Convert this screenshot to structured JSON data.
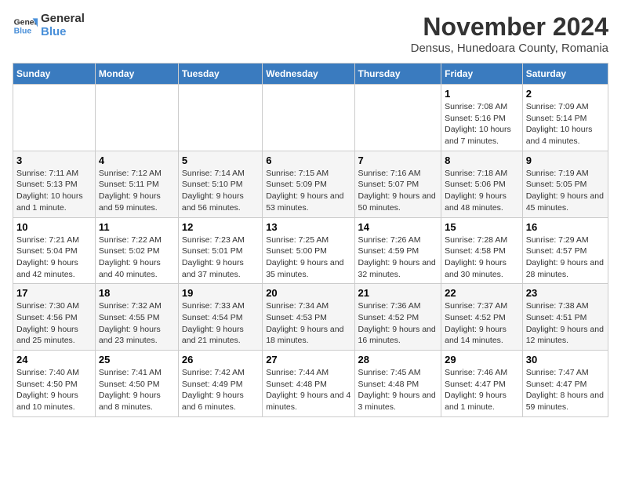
{
  "logo": {
    "line1": "General",
    "line2": "Blue"
  },
  "title": "November 2024",
  "subtitle": "Densus, Hunedoara County, Romania",
  "headers": [
    "Sunday",
    "Monday",
    "Tuesday",
    "Wednesday",
    "Thursday",
    "Friday",
    "Saturday"
  ],
  "weeks": [
    [
      {
        "day": "",
        "info": ""
      },
      {
        "day": "",
        "info": ""
      },
      {
        "day": "",
        "info": ""
      },
      {
        "day": "",
        "info": ""
      },
      {
        "day": "",
        "info": ""
      },
      {
        "day": "1",
        "info": "Sunrise: 7:08 AM\nSunset: 5:16 PM\nDaylight: 10 hours and 7 minutes."
      },
      {
        "day": "2",
        "info": "Sunrise: 7:09 AM\nSunset: 5:14 PM\nDaylight: 10 hours and 4 minutes."
      }
    ],
    [
      {
        "day": "3",
        "info": "Sunrise: 7:11 AM\nSunset: 5:13 PM\nDaylight: 10 hours and 1 minute."
      },
      {
        "day": "4",
        "info": "Sunrise: 7:12 AM\nSunset: 5:11 PM\nDaylight: 9 hours and 59 minutes."
      },
      {
        "day": "5",
        "info": "Sunrise: 7:14 AM\nSunset: 5:10 PM\nDaylight: 9 hours and 56 minutes."
      },
      {
        "day": "6",
        "info": "Sunrise: 7:15 AM\nSunset: 5:09 PM\nDaylight: 9 hours and 53 minutes."
      },
      {
        "day": "7",
        "info": "Sunrise: 7:16 AM\nSunset: 5:07 PM\nDaylight: 9 hours and 50 minutes."
      },
      {
        "day": "8",
        "info": "Sunrise: 7:18 AM\nSunset: 5:06 PM\nDaylight: 9 hours and 48 minutes."
      },
      {
        "day": "9",
        "info": "Sunrise: 7:19 AM\nSunset: 5:05 PM\nDaylight: 9 hours and 45 minutes."
      }
    ],
    [
      {
        "day": "10",
        "info": "Sunrise: 7:21 AM\nSunset: 5:04 PM\nDaylight: 9 hours and 42 minutes."
      },
      {
        "day": "11",
        "info": "Sunrise: 7:22 AM\nSunset: 5:02 PM\nDaylight: 9 hours and 40 minutes."
      },
      {
        "day": "12",
        "info": "Sunrise: 7:23 AM\nSunset: 5:01 PM\nDaylight: 9 hours and 37 minutes."
      },
      {
        "day": "13",
        "info": "Sunrise: 7:25 AM\nSunset: 5:00 PM\nDaylight: 9 hours and 35 minutes."
      },
      {
        "day": "14",
        "info": "Sunrise: 7:26 AM\nSunset: 4:59 PM\nDaylight: 9 hours and 32 minutes."
      },
      {
        "day": "15",
        "info": "Sunrise: 7:28 AM\nSunset: 4:58 PM\nDaylight: 9 hours and 30 minutes."
      },
      {
        "day": "16",
        "info": "Sunrise: 7:29 AM\nSunset: 4:57 PM\nDaylight: 9 hours and 28 minutes."
      }
    ],
    [
      {
        "day": "17",
        "info": "Sunrise: 7:30 AM\nSunset: 4:56 PM\nDaylight: 9 hours and 25 minutes."
      },
      {
        "day": "18",
        "info": "Sunrise: 7:32 AM\nSunset: 4:55 PM\nDaylight: 9 hours and 23 minutes."
      },
      {
        "day": "19",
        "info": "Sunrise: 7:33 AM\nSunset: 4:54 PM\nDaylight: 9 hours and 21 minutes."
      },
      {
        "day": "20",
        "info": "Sunrise: 7:34 AM\nSunset: 4:53 PM\nDaylight: 9 hours and 18 minutes."
      },
      {
        "day": "21",
        "info": "Sunrise: 7:36 AM\nSunset: 4:52 PM\nDaylight: 9 hours and 16 minutes."
      },
      {
        "day": "22",
        "info": "Sunrise: 7:37 AM\nSunset: 4:52 PM\nDaylight: 9 hours and 14 minutes."
      },
      {
        "day": "23",
        "info": "Sunrise: 7:38 AM\nSunset: 4:51 PM\nDaylight: 9 hours and 12 minutes."
      }
    ],
    [
      {
        "day": "24",
        "info": "Sunrise: 7:40 AM\nSunset: 4:50 PM\nDaylight: 9 hours and 10 minutes."
      },
      {
        "day": "25",
        "info": "Sunrise: 7:41 AM\nSunset: 4:50 PM\nDaylight: 9 hours and 8 minutes."
      },
      {
        "day": "26",
        "info": "Sunrise: 7:42 AM\nSunset: 4:49 PM\nDaylight: 9 hours and 6 minutes."
      },
      {
        "day": "27",
        "info": "Sunrise: 7:44 AM\nSunset: 4:48 PM\nDaylight: 9 hours and 4 minutes."
      },
      {
        "day": "28",
        "info": "Sunrise: 7:45 AM\nSunset: 4:48 PM\nDaylight: 9 hours and 3 minutes."
      },
      {
        "day": "29",
        "info": "Sunrise: 7:46 AM\nSunset: 4:47 PM\nDaylight: 9 hours and 1 minute."
      },
      {
        "day": "30",
        "info": "Sunrise: 7:47 AM\nSunset: 4:47 PM\nDaylight: 8 hours and 59 minutes."
      }
    ]
  ]
}
